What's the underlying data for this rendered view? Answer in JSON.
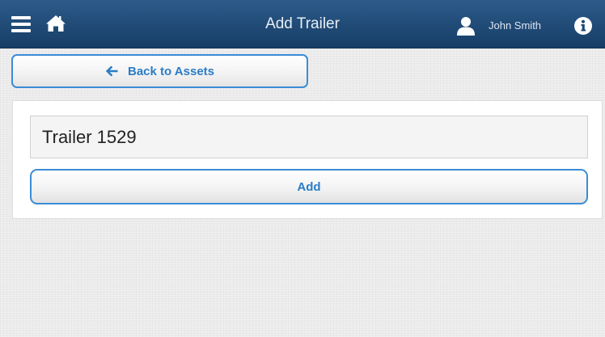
{
  "header": {
    "title": "Add Trailer",
    "user_name": "John Smith",
    "menu_icon": "hamburger-menu-icon",
    "home_icon": "home-icon",
    "user_icon": "user-icon",
    "info_icon": "info-icon"
  },
  "nav": {
    "back_label": "Back to Assets",
    "back_icon": "arrow-left-icon"
  },
  "form": {
    "trailer_value": "Trailer 1529",
    "add_label": "Add"
  },
  "colors": {
    "header_top": "#2d5b8a",
    "header_bottom": "#163d66",
    "accent": "#2b7cc6",
    "button_border": "#3a8cd6"
  }
}
